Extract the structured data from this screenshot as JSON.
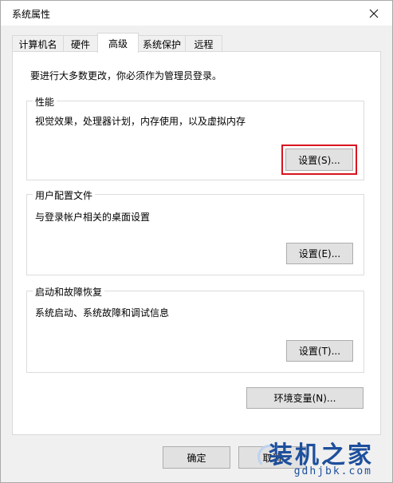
{
  "window": {
    "title": "系统属性"
  },
  "tabs": [
    {
      "label": "计算机名"
    },
    {
      "label": "硬件"
    },
    {
      "label": "高级"
    },
    {
      "label": "系统保护"
    },
    {
      "label": "远程"
    }
  ],
  "active_tab": "高级",
  "admin_note": "要进行大多数更改，你必须作为管理员登录。",
  "performance": {
    "title": "性能",
    "description": "视觉效果，处理器计划，内存使用，以及虚拟内存",
    "button": "设置(S)..."
  },
  "user_profiles": {
    "title": "用户配置文件",
    "description": "与登录帐户相关的桌面设置",
    "button": "设置(E)..."
  },
  "startup_recovery": {
    "title": "启动和故障恢复",
    "description": "系统启动、系统故障和调试信息",
    "button": "设置(T)..."
  },
  "env_button": "环境变量(N)...",
  "footer": {
    "ok": "确定",
    "cancel": "取消"
  },
  "watermark": {
    "text": "装机之家",
    "url": "gdhjbk.com"
  },
  "colors": {
    "highlight": "#d9141e",
    "watermark": "#1d4f9c"
  },
  "icons": {
    "close": "close-icon"
  }
}
